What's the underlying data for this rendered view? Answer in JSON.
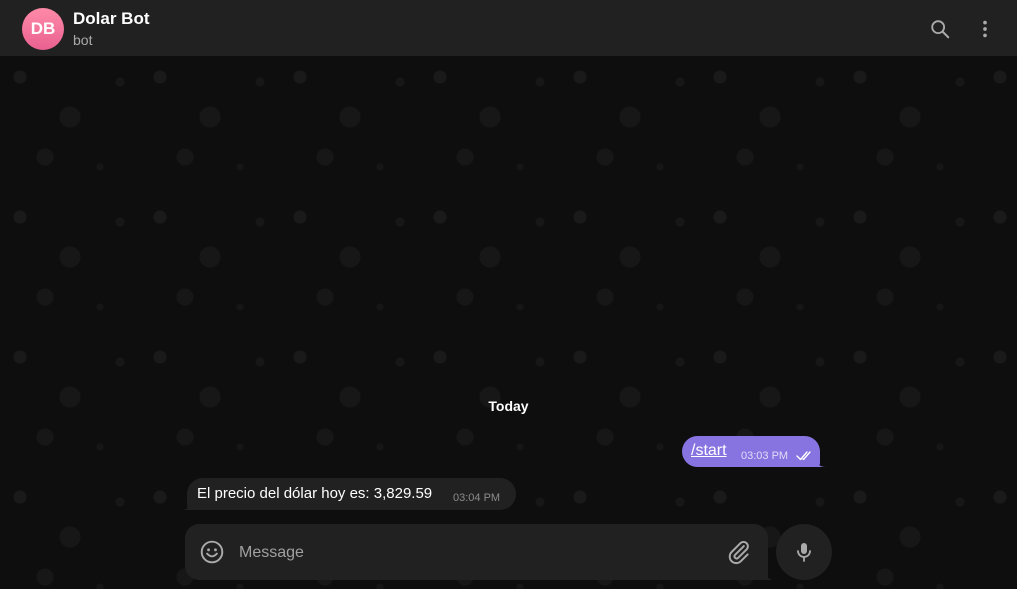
{
  "header": {
    "avatar_initials": "DB",
    "avatar_color": "#ee6f9a",
    "title": "Dolar Bot",
    "subtitle": "bot",
    "actions": [
      {
        "icon": "search-icon"
      },
      {
        "icon": "more-vertical-icon"
      }
    ]
  },
  "chat": {
    "date_label": "Today",
    "messages": [
      {
        "direction": "outgoing",
        "text": "/start",
        "time": "03:03 PM",
        "status_icon": "double-check-icon",
        "bubble_color": "#8774e1"
      },
      {
        "direction": "incoming",
        "text": "El precio del dólar hoy es: 3,829.59",
        "time": "03:04 PM",
        "bubble_color": "#212121"
      }
    ]
  },
  "composer": {
    "placeholder": "Message",
    "value": "",
    "icons": [
      "smile-icon",
      "paperclip-icon",
      "microphone-icon"
    ]
  },
  "colors": {
    "accent": "#8774e1",
    "header_bg": "#212121",
    "chat_bg": "#0f0f0f"
  }
}
